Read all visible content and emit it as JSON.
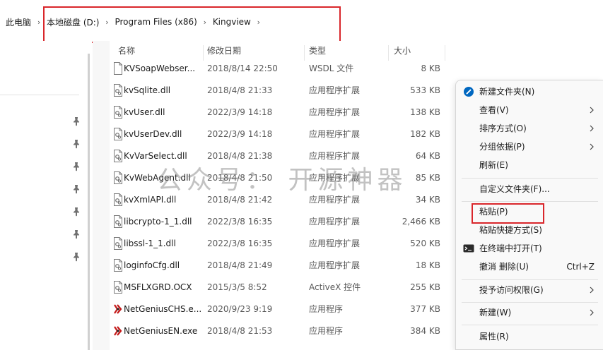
{
  "breadcrumb": {
    "items": [
      "此电脑",
      "本地磁盘 (D:)",
      "Program Files (x86)",
      "Kingview"
    ]
  },
  "columns": {
    "name": "名称",
    "date": "修改日期",
    "type": "类型",
    "size": "大小"
  },
  "files": [
    {
      "name": "KVSoapWebser...",
      "date": "2018/8/14 22:50",
      "type": "WSDL 文件",
      "size": "8 KB",
      "icon": "document-icon"
    },
    {
      "name": "kvSqlite.dll",
      "date": "2018/4/8 21:33",
      "type": "应用程序扩展",
      "size": "533 KB",
      "icon": "dll-file-icon"
    },
    {
      "name": "kvUser.dll",
      "date": "2022/3/9 14:18",
      "type": "应用程序扩展",
      "size": "138 KB",
      "icon": "dll-file-icon"
    },
    {
      "name": "kvUserDev.dll",
      "date": "2022/3/9 14:18",
      "type": "应用程序扩展",
      "size": "182 KB",
      "icon": "dll-file-icon"
    },
    {
      "name": "KvVarSelect.dll",
      "date": "2018/4/8 21:38",
      "type": "应用程序扩展",
      "size": "64 KB",
      "icon": "dll-file-icon"
    },
    {
      "name": "KvWebAgent.dll",
      "date": "2018/4/8 21:50",
      "type": "应用程序扩展",
      "size": "85 KB",
      "icon": "dll-file-icon"
    },
    {
      "name": "kvXmlAPI.dll",
      "date": "2018/4/8 21:42",
      "type": "应用程序扩展",
      "size": "34 KB",
      "icon": "dll-file-icon"
    },
    {
      "name": "libcrypto-1_1.dll",
      "date": "2022/3/8 16:35",
      "type": "应用程序扩展",
      "size": "2,466 KB",
      "icon": "dll-file-icon"
    },
    {
      "name": "libssl-1_1.dll",
      "date": "2022/3/8 16:35",
      "type": "应用程序扩展",
      "size": "520 KB",
      "icon": "dll-file-icon"
    },
    {
      "name": "loginfoCfg.dll",
      "date": "2018/4/8 21:49",
      "type": "应用程序扩展",
      "size": "18 KB",
      "icon": "dll-file-icon"
    },
    {
      "name": "MSFLXGRD.OCX",
      "date": "2015/3/5 8:52",
      "type": "ActiveX 控件",
      "size": "255 KB",
      "icon": "dll-file-icon"
    },
    {
      "name": "NetGeniusCHS.e...",
      "date": "2020/9/23 9:19",
      "type": "应用程序",
      "size": "377 KB",
      "icon": "app-exe-icon"
    },
    {
      "name": "NetGeniusEN.exe",
      "date": "2018/4/8 21:53",
      "type": "应用程序",
      "size": "384 KB",
      "icon": "app-exe-icon"
    }
  ],
  "watermark": "公众号： 开源神器",
  "context_menu": {
    "new_folder": "新建文件夹(N)",
    "view": "查看(V)",
    "sort_by": "排序方式(O)",
    "group_by": "分组依据(P)",
    "refresh": "刷新(E)",
    "customize": "自定义文件夹(F)...",
    "paste": "粘贴(P)",
    "paste_shortcut": "粘贴快捷方式(S)",
    "open_terminal": "在终端中打开(T)",
    "undo_delete": "撤消 删除(U)",
    "undo_shortcut": "Ctrl+Z",
    "grant_access": "授予访问权限(G)",
    "new": "新建(W)",
    "properties": "属性(R)"
  },
  "colors": {
    "highlight": "#d9262b",
    "accent": "#0067c0"
  }
}
